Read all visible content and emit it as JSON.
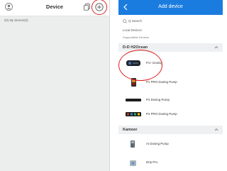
{
  "left_screen": {
    "title": "Device",
    "my_devices_label": "I(0) My devices(0)",
    "icons": {
      "avatar": "person-icon",
      "copy": "copy-icon",
      "add": "add-icon"
    }
  },
  "right_screen": {
    "title": "Add device",
    "search_placeholder": "Q Search",
    "local_devices": "Local Devices",
    "supportable_devices": "Supportable Devices",
    "sections": [
      {
        "label": "D-D H2Ocean",
        "items": [
          {
            "name": "P1+ Dosing"
          },
          {
            "name": "P1 PRO Dosing Pump"
          },
          {
            "name": "P4 Dosing Pump"
          },
          {
            "name": "P4 PRO Dosing Pump"
          }
        ]
      },
      {
        "label": "Kamoer",
        "items": [
          {
            "name": "AI Dosing Pump"
          },
          {
            "name": "Drip Pro"
          }
        ]
      }
    ],
    "header_color": "#1b7ce0"
  },
  "annotation_color": "#e02020"
}
